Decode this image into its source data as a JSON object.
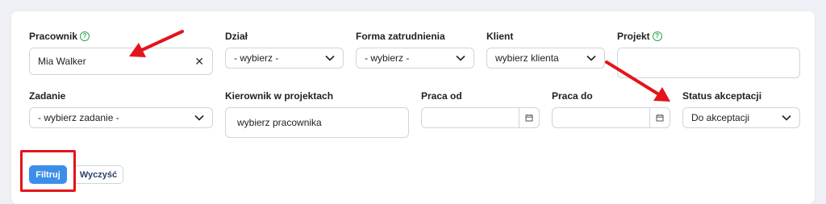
{
  "filters": {
    "pracownik": {
      "label": "Pracownik",
      "value": "Mia Walker",
      "clear_icon": "close-icon"
    },
    "dzial": {
      "label": "Dział",
      "value": "- wybierz -"
    },
    "forma": {
      "label": "Forma zatrudnienia",
      "value": "- wybierz -"
    },
    "klient": {
      "label": "Klient",
      "value": "wybierz klienta"
    },
    "projekt": {
      "label": "Projekt",
      "value": ""
    },
    "zadanie": {
      "label": "Zadanie",
      "value": "- wybierz zadanie -"
    },
    "kierownik": {
      "label": "Kierownik w projektach",
      "value": "wybierz pracownika"
    },
    "praca_od": {
      "label": "Praca od",
      "value": ""
    },
    "praca_do": {
      "label": "Praca do",
      "value": ""
    },
    "status": {
      "label": "Status akceptacji",
      "value": "Do akceptacji"
    }
  },
  "help_glyph": "?",
  "actions": {
    "filter_label": "Filtruj",
    "clear_label": "Wyczyść"
  },
  "annotations": {
    "color": "#e3141b",
    "items": [
      "arrow-to-pracownik",
      "arrow-to-status",
      "highlight-filter-button"
    ]
  },
  "colors": {
    "primary": "#3c8ee8",
    "help": "#2da44e",
    "background": "#eef0f5"
  }
}
